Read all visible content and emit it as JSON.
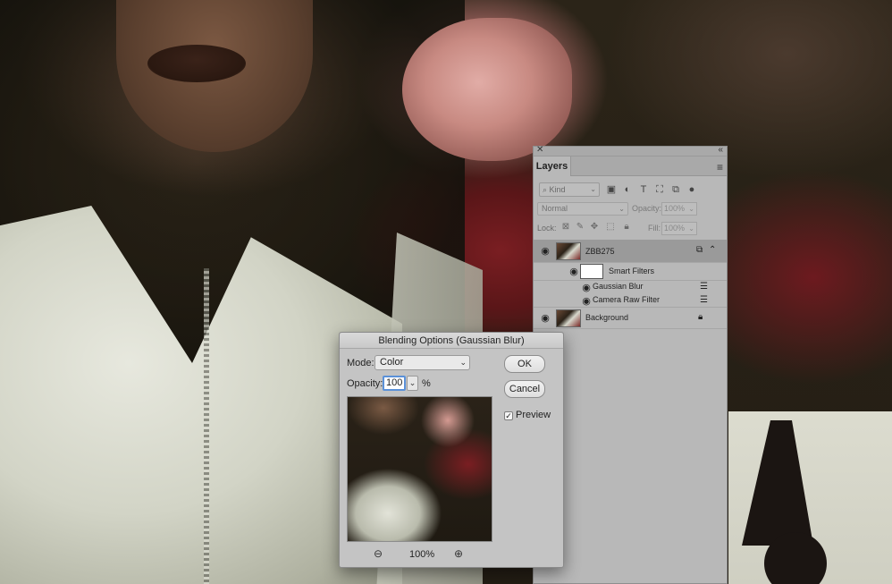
{
  "layers_panel": {
    "tab_label": "Layers",
    "filter_kind": "Kind",
    "blend_mode": "Normal",
    "opacity_label": "Opacity:",
    "opacity_value": "100%",
    "lock_label": "Lock:",
    "fill_label": "Fill:",
    "fill_value": "100%",
    "layers": [
      {
        "name": "ZBB275"
      },
      {
        "name": "Smart Filters"
      },
      {
        "name": "Gaussian Blur"
      },
      {
        "name": "Camera Raw Filter"
      },
      {
        "name": "Background"
      }
    ]
  },
  "dialog": {
    "title": "Blending Options (Gaussian Blur)",
    "mode_label": "Mode:",
    "mode_value": "Color",
    "opacity_label": "Opacity:",
    "opacity_value": "100",
    "percent_sign": "%",
    "ok_label": "OK",
    "cancel_label": "Cancel",
    "preview_label": "Preview",
    "preview_checked": true,
    "zoom_level": "100%"
  },
  "icons": {
    "close": "close-icon",
    "collapse": "double-chevron-icon",
    "menu": "hamburger-icon",
    "visibility": "eye-icon",
    "zoom_in": "zoom-in-icon",
    "zoom_out": "zoom-out-icon",
    "lock": "lock-icon"
  },
  "colors": {
    "panel_bg": "#b8b8b8",
    "dialog_bg": "#c4c4c4",
    "focus_ring": "#5b91d8",
    "selected_row": "#9a9a9a"
  }
}
